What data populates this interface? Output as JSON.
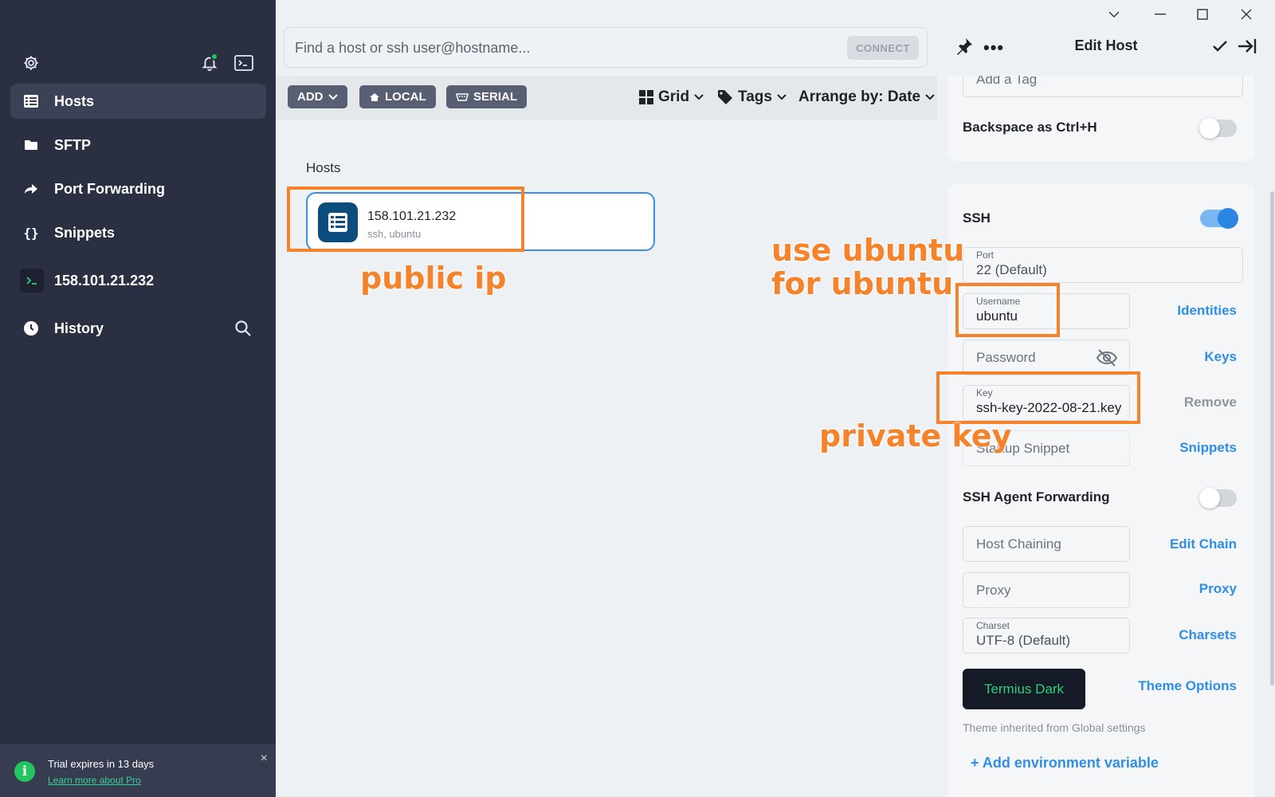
{
  "sidebar": {
    "nav": [
      {
        "label": "Hosts",
        "icon": "hosts-icon",
        "active": true
      },
      {
        "label": "SFTP",
        "icon": "folder-icon",
        "active": false
      },
      {
        "label": "Port Forwarding",
        "icon": "port-forwarding-icon",
        "active": false
      },
      {
        "label": "Snippets",
        "icon": "snippets-icon",
        "active": false
      }
    ],
    "session": {
      "label": "158.101.21.232",
      "icon": "terminal-icon"
    },
    "history": {
      "label": "History",
      "icon": "history-icon"
    },
    "trial": {
      "text": "Trial expires in 13 days",
      "link": "Learn more about Pro",
      "close": "×"
    }
  },
  "main": {
    "search": {
      "placeholder": "Find a host or ssh user@hostname...",
      "connect_label": "CONNECT"
    },
    "toolbar": {
      "add_label": "ADD",
      "local_label": "LOCAL",
      "serial_label": "SERIAL",
      "view_label": "Grid",
      "tags_label": "Tags",
      "arrange_label": "Arrange by: Date"
    },
    "section_title": "Hosts",
    "host": {
      "name": "158.101.21.232",
      "subtitle": "ssh, ubuntu"
    }
  },
  "panel": {
    "title": "Edit Host",
    "tag_placeholder": "Add a Tag",
    "backspace_label": "Backspace as Ctrl+H",
    "backspace_on": false,
    "ssh_label": "SSH",
    "ssh_on": true,
    "port": {
      "label": "Port",
      "value": "22 (Default)"
    },
    "username": {
      "label": "Username",
      "value": "ubuntu"
    },
    "identities_link": "Identities",
    "password_placeholder": "Password",
    "keys_link": "Keys",
    "key": {
      "label": "Key",
      "value": "ssh-key-2022-08-21.key"
    },
    "remove_link": "Remove",
    "startup_placeholder": "Startup Snippet",
    "snippets_link": "Snippets",
    "agent_forwarding_label": "SSH Agent Forwarding",
    "agent_forwarding_on": false,
    "host_chaining_placeholder": "Host Chaining",
    "edit_chain_link": "Edit Chain",
    "proxy_placeholder": "Proxy",
    "proxy_link": "Proxy",
    "charset": {
      "label": "Charset",
      "value": "UTF-8 (Default)"
    },
    "charsets_link": "Charsets",
    "theme_button": "Termius Dark",
    "theme_options_link": "Theme Options",
    "theme_note": "Theme inherited from Global settings",
    "add_env": "+ Add environment variable"
  },
  "annotations": {
    "public_ip": "public ip",
    "use_ubuntu": "use ubuntu",
    "for_ubuntu": "for ubuntu",
    "private_key": "private key",
    "color": "#f4832b"
  },
  "colors": {
    "sidebar_bg": "#2a2f42",
    "accent": "#2f8ee6",
    "trial_green": "#22c55e",
    "host_icon_bg": "#0b4e7e"
  }
}
